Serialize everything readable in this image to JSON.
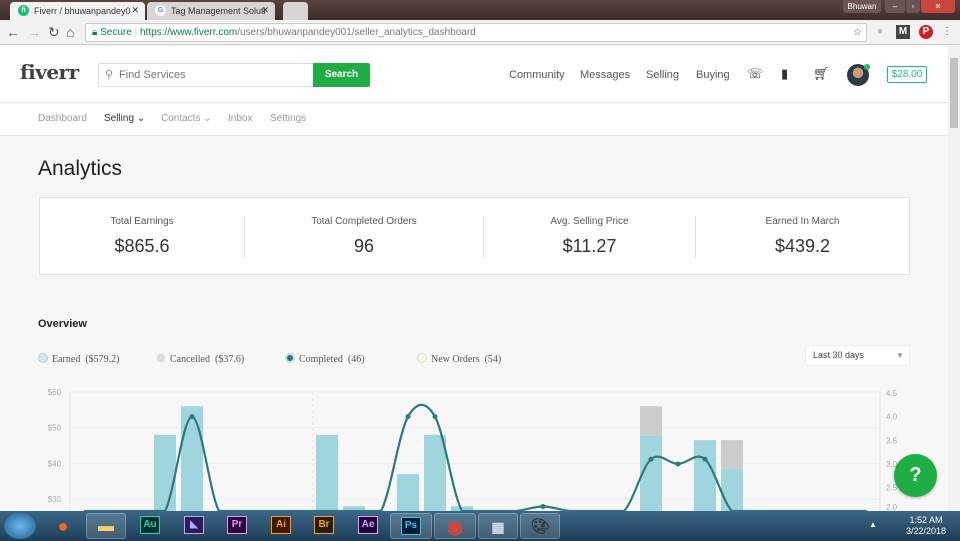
{
  "browser": {
    "tabs": [
      {
        "label": "Fiverr / bhuwanpandey0",
        "favicon": "fi"
      },
      {
        "label": "Tag Management Soluti",
        "favicon": "G"
      }
    ],
    "user": "Bhuwan",
    "secure_label": "Secure",
    "url_scheme_host": "https://www.fiverr.com",
    "url_path": "/users/bhuwanpandey001/seller_analytics_dashboard"
  },
  "header": {
    "logo": "fiverr",
    "search_placeholder": "Find Services",
    "search_button": "Search",
    "links": [
      "Community",
      "Messages",
      "Selling",
      "Buying"
    ],
    "balance": "$28.00"
  },
  "subnav": {
    "items": [
      "Dashboard",
      "Selling",
      "Contacts",
      "Inbox",
      "Settings"
    ],
    "active": "Selling"
  },
  "page": {
    "title": "Analytics",
    "stats": [
      {
        "label": "Total Earnings",
        "value": "$865.6"
      },
      {
        "label": "Total Completed Orders",
        "value": "96"
      },
      {
        "label": "Avg. Selling Price",
        "value": "$11.27"
      },
      {
        "label": "Earned In March",
        "value": "$439.2"
      }
    ],
    "overview_title": "Overview",
    "range": "Last 30 days",
    "help": "?"
  },
  "chart_data": {
    "type": "bar",
    "legend": [
      {
        "label": "Earned",
        "value": "($579.2)",
        "color": "#9fd6de"
      },
      {
        "label": "Cancelled",
        "value": "($37.6)",
        "color": "#cccccc"
      },
      {
        "label": "Completed",
        "value": "(46)",
        "color": "#2e7a7a"
      },
      {
        "label": "New Orders",
        "value": "(54)",
        "color": "#f4f4e8"
      }
    ],
    "left_ticks": [
      "$60",
      "$50",
      "$40",
      "$30"
    ],
    "left_tick_values": [
      60,
      50,
      40,
      30
    ],
    "right_ticks": [
      "4.5",
      "4.0",
      "3.5",
      "3.0",
      "2.5",
      "2.0"
    ],
    "right_tick_values": [
      4.5,
      4.0,
      3.5,
      3.0,
      2.5,
      2.0
    ],
    "days": 30,
    "earned": [
      0,
      0,
      0,
      48,
      56,
      0,
      0,
      0,
      0,
      48,
      28,
      0,
      37,
      48,
      28,
      0,
      0,
      0,
      0,
      0,
      0,
      47.7,
      0,
      46.5,
      38.5,
      0,
      0,
      0,
      0,
      0
    ],
    "cancelled": [
      0,
      0,
      0,
      0,
      0,
      0,
      0,
      0,
      0,
      0,
      0,
      0,
      0,
      0,
      0,
      0,
      0,
      0,
      0,
      0,
      0,
      8.3,
      0,
      0,
      8,
      0,
      0,
      0,
      0,
      0
    ],
    "completed": [
      1,
      1,
      1,
      0,
      4,
      0,
      1,
      2,
      1,
      2,
      2,
      0,
      4,
      4,
      0,
      1,
      1,
      2.1,
      1,
      0,
      0,
      3.1,
      3,
      3.1,
      0,
      1,
      2,
      1,
      2,
      1
    ]
  },
  "taskbar": {
    "apps": [
      "Au",
      "An",
      "Pr",
      "Ai",
      "Br",
      "Ae",
      "Ps"
    ],
    "time": "1:52 AM",
    "date": "3/22/2018"
  }
}
